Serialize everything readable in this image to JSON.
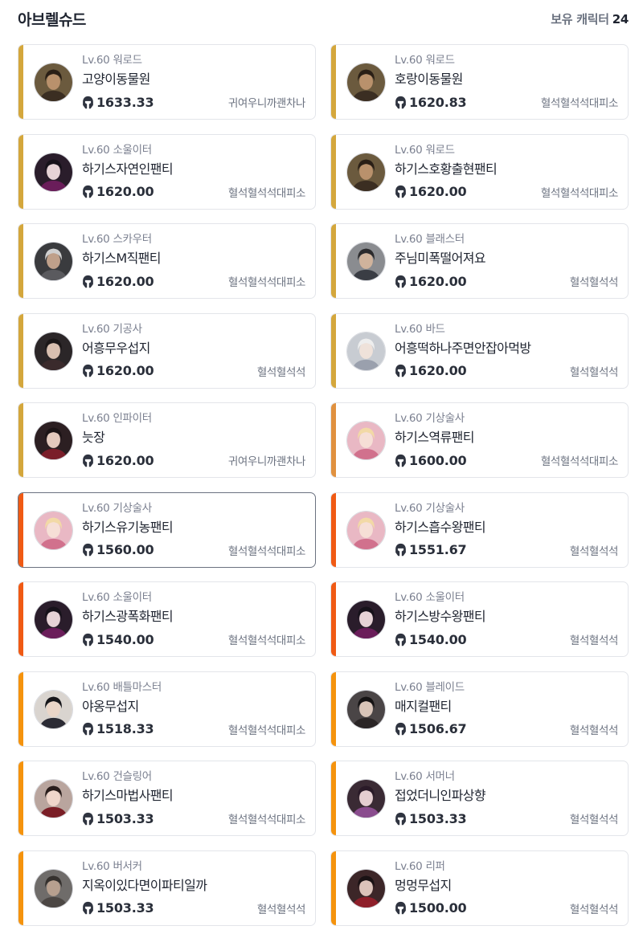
{
  "header": {
    "server": "아브렐슈드",
    "owned_label": "보유 캐릭터",
    "owned_count": "24"
  },
  "level_prefix": "Lv.60",
  "colors": {
    "gold": "#d4a73c",
    "amber": "#e0913f",
    "red": "#f05a14",
    "orange": "#f5930d"
  },
  "characters": [
    {
      "cls": "워로드",
      "name": "고양이동물원",
      "ilvl": "1633.33",
      "guild": "귀여우니까괜차나",
      "tier": "gold",
      "avatar": "warlord"
    },
    {
      "cls": "워로드",
      "name": "호랑이동물원",
      "ilvl": "1620.83",
      "guild": "혈석혈석석대피소",
      "tier": "gold",
      "avatar": "warlord"
    },
    {
      "cls": "소울이터",
      "name": "하기스자연인팬티",
      "ilvl": "1620.00",
      "guild": "혈석혈석석대피소",
      "tier": "gold",
      "avatar": "souleater"
    },
    {
      "cls": "워로드",
      "name": "하기스호황출현팬티",
      "ilvl": "1620.00",
      "guild": "혈석혈석석대피소",
      "tier": "gold",
      "avatar": "warlord"
    },
    {
      "cls": "스카우터",
      "name": "하기스M직팬티",
      "ilvl": "1620.00",
      "guild": "혈석혈석석대피소",
      "tier": "gold",
      "avatar": "scouter"
    },
    {
      "cls": "블래스터",
      "name": "주님미폭떨어져요",
      "ilvl": "1620.00",
      "guild": "혈석혈석석",
      "tier": "gold",
      "avatar": "blaster"
    },
    {
      "cls": "기공사",
      "name": "어흥무우섭지",
      "ilvl": "1620.00",
      "guild": "혈석혈석석",
      "tier": "gold",
      "avatar": "soulfist"
    },
    {
      "cls": "바드",
      "name": "어흥떡하나주면안잡아먹방",
      "ilvl": "1620.00",
      "guild": "혈석혈석석",
      "tier": "gold",
      "avatar": "bard"
    },
    {
      "cls": "인파이터",
      "name": "늣장",
      "ilvl": "1620.00",
      "guild": "귀여우니까괜차나",
      "tier": "gold",
      "avatar": "infighter"
    },
    {
      "cls": "기상술사",
      "name": "하기스역류팬티",
      "ilvl": "1600.00",
      "guild": "혈석혈석석대피소",
      "tier": "amber",
      "avatar": "aeromancer"
    },
    {
      "cls": "기상술사",
      "name": "하기스유기농팬티",
      "ilvl": "1560.00",
      "guild": "혈석혈석석대피소",
      "tier": "red",
      "avatar": "aeromancer",
      "selected": true
    },
    {
      "cls": "기상술사",
      "name": "하기스흡수왕팬티",
      "ilvl": "1551.67",
      "guild": "혈석혈석석",
      "tier": "red",
      "avatar": "aeromancer"
    },
    {
      "cls": "소울이터",
      "name": "하기스광폭화팬티",
      "ilvl": "1540.00",
      "guild": "혈석혈석석대피소",
      "tier": "red",
      "avatar": "souleater"
    },
    {
      "cls": "소울이터",
      "name": "하기스방수왕팬티",
      "ilvl": "1540.00",
      "guild": "혈석혈석석",
      "tier": "red",
      "avatar": "souleater"
    },
    {
      "cls": "배틀마스터",
      "name": "야옹무섭지",
      "ilvl": "1518.33",
      "guild": "혈석혈석석대피소",
      "tier": "orange",
      "avatar": "battlemaster"
    },
    {
      "cls": "블레이드",
      "name": "매지컬팬티",
      "ilvl": "1506.67",
      "guild": "혈석혈석석",
      "tier": "orange",
      "avatar": "blade"
    },
    {
      "cls": "건슬링어",
      "name": "하기스마법사팬티",
      "ilvl": "1503.33",
      "guild": "혈석혈석석대피소",
      "tier": "orange",
      "avatar": "gunslinger"
    },
    {
      "cls": "서머너",
      "name": "접었더니인파상향",
      "ilvl": "1503.33",
      "guild": "혈석혈석석",
      "tier": "orange",
      "avatar": "summoner"
    },
    {
      "cls": "버서커",
      "name": "지옥이있다면이파티일까",
      "ilvl": "1503.33",
      "guild": "혈석혈석석",
      "tier": "orange",
      "avatar": "berserker"
    },
    {
      "cls": "리퍼",
      "name": "멍멍무섭지",
      "ilvl": "1500.00",
      "guild": "혈석혈석석",
      "tier": "orange",
      "avatar": "reaper"
    }
  ]
}
